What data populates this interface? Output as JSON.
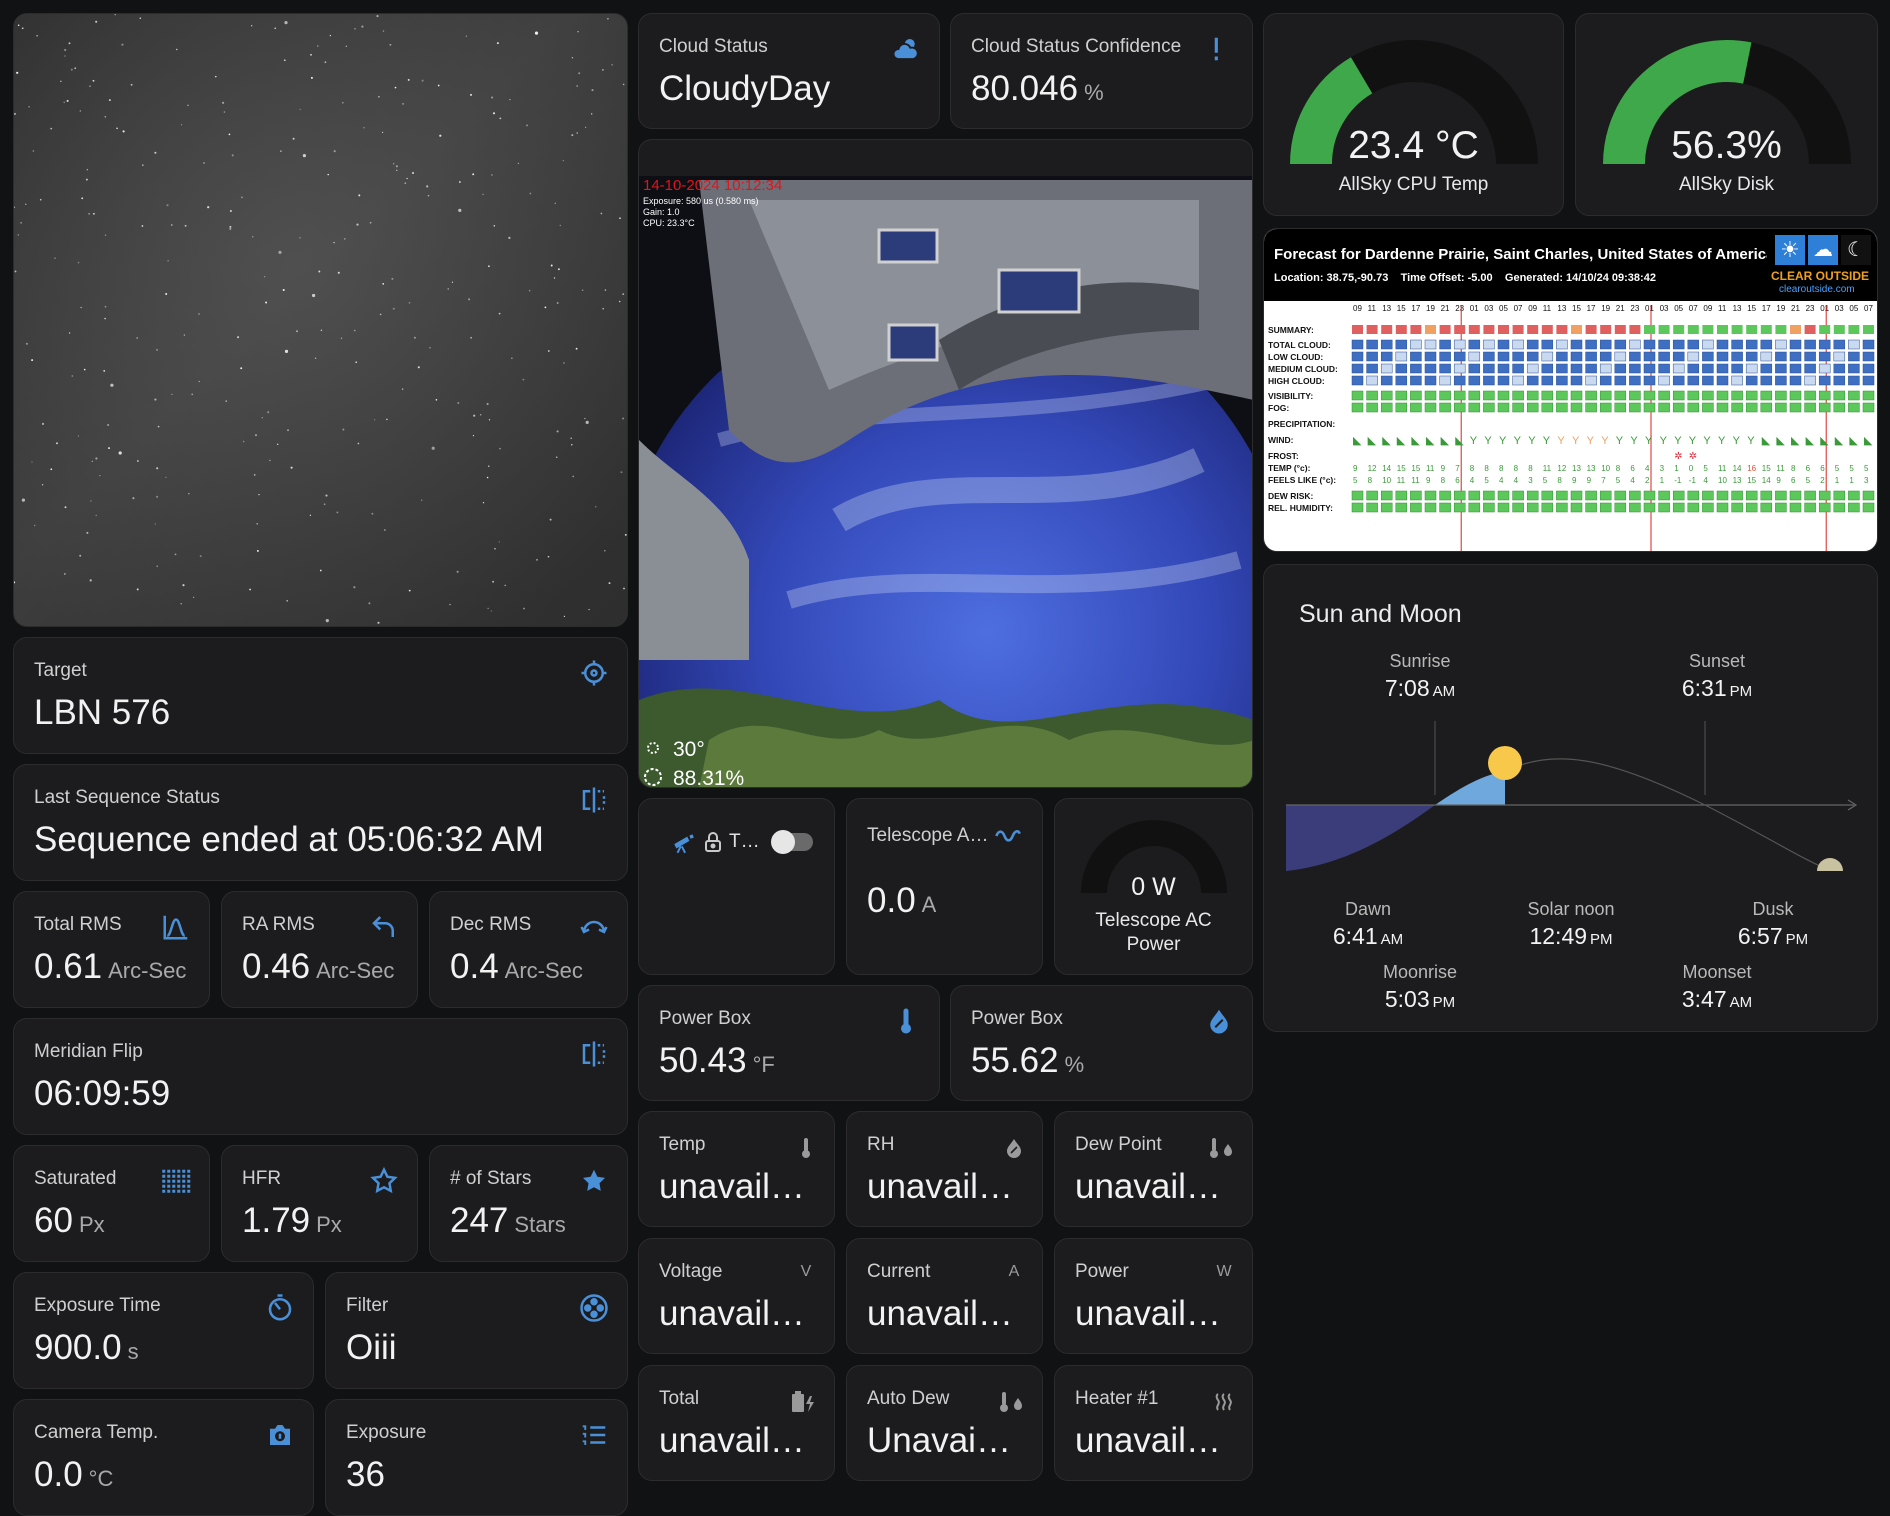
{
  "allsky_image": {},
  "target": {
    "label": "Target",
    "value": "LBN 576"
  },
  "last_sequence": {
    "label": "Last Sequence Status",
    "value": "Sequence ended at 05:06:32 AM"
  },
  "total_rms": {
    "label": "Total RMS",
    "value": "0.61",
    "unit": "Arc-Sec"
  },
  "ra_rms": {
    "label": "RA RMS",
    "value": "0.46",
    "unit": "Arc-Sec"
  },
  "dec_rms": {
    "label": "Dec RMS",
    "value": "0.4",
    "unit": "Arc-Sec"
  },
  "meridian_flip": {
    "label": "Meridian Flip",
    "value": "06:09:59"
  },
  "saturated": {
    "label": "Saturated",
    "value": "60",
    "unit": "Px"
  },
  "hfr": {
    "label": "HFR",
    "value": "1.79",
    "unit": "Px"
  },
  "stars": {
    "label": "# of Stars",
    "value": "247",
    "unit": "Stars"
  },
  "exposure_time": {
    "label": "Exposure Time",
    "value": "900.0",
    "unit": "s"
  },
  "filter": {
    "label": "Filter",
    "value": "Oiii"
  },
  "camera_temp": {
    "label": "Camera Temp.",
    "value": "0.0",
    "unit": "°C"
  },
  "exposure": {
    "label": "Exposure",
    "value": "36"
  },
  "cloud_status": {
    "label": "Cloud Status",
    "value": "CloudyDay"
  },
  "cloud_confidence": {
    "label": "Cloud Status Confidence",
    "value": "80.046",
    "unit": "%"
  },
  "fisheye": {
    "timestamp": "14-10-2024 10:12:34",
    "exposure_line": "Exposure: 580 us (0.580 ms)",
    "gain_line": "Gain: 1.0",
    "cpu_line": "CPU: 23.3°C",
    "sun_alt": "30°",
    "moon_illum": "88.31%"
  },
  "telescope_switch": {
    "label": "T…",
    "on": false
  },
  "telescope_amps": {
    "label": "Telescope A…",
    "value": "0.0",
    "unit": "A"
  },
  "telescope_power": {
    "value": "0 W",
    "label_line1": "Telescope AC",
    "label_line2": "Power",
    "level": 0
  },
  "power_box_temp": {
    "label": "Power Box",
    "value": "50.43",
    "unit": "°F"
  },
  "power_box_hum": {
    "label": "Power Box",
    "value": "55.62",
    "unit": "%"
  },
  "small_tiles": {
    "temp": {
      "label": "Temp",
      "value": "unavaila…"
    },
    "rh": {
      "label": "RH",
      "value": "unavaila…"
    },
    "dew_point": {
      "label": "Dew Point",
      "value": "unavaila…"
    },
    "voltage": {
      "label": "Voltage",
      "value": "unavaila…",
      "icon": "V"
    },
    "current": {
      "label": "Current",
      "value": "unavaila…",
      "icon": "A"
    },
    "power": {
      "label": "Power",
      "value": "unavaila…",
      "icon": "W"
    },
    "total": {
      "label": "Total",
      "value": "unavaila…"
    },
    "auto_dew": {
      "label": "Auto Dew",
      "value": "Unavaila…"
    },
    "heater1": {
      "label": "Heater #1",
      "value": "unavaila…"
    }
  },
  "cpu_temp": {
    "value": "23.4 °C",
    "label": "AllSky CPU Temp",
    "level": 0.33
  },
  "disk": {
    "value": "56.3%",
    "label": "AllSky Disk",
    "level": 0.563
  },
  "clear_outside": {
    "title": "Forecast for Dardenne Prairie, Saint Charles, United States of America",
    "location": "Location: 38.75,-90.73",
    "offset": "Time Offset: -5.00",
    "generated": "Generated: 14/10/24 09:38:42",
    "brand": "CLEAR OUTSIDE",
    "site": "clearoutside.com",
    "hours": [
      "09",
      "11",
      "13",
      "15",
      "17",
      "19",
      "21",
      "23",
      "01",
      "03",
      "05",
      "07",
      "09",
      "11",
      "13",
      "15",
      "17",
      "19",
      "21",
      "23",
      "01",
      "03",
      "05",
      "07",
      "09",
      "11",
      "13",
      "15",
      "17",
      "19",
      "21",
      "23",
      "01",
      "03",
      "05",
      "07"
    ],
    "rows": [
      "SUMMARY:",
      "TOTAL CLOUD:",
      "LOW CLOUD:",
      "MEDIUM CLOUD:",
      "HIGH CLOUD:",
      "VISIBILITY:",
      "FOG:",
      "PRECIPITATION:",
      "WIND:",
      "FROST:",
      "TEMP (°c):",
      "FEELS LIKE (°c):",
      "DEW RISK:",
      "REL. HUMIDITY:"
    ],
    "summary": [
      "r",
      "r",
      "r",
      "r",
      "r",
      "o",
      "r",
      "r",
      "r",
      "r",
      "r",
      "r",
      "r",
      "r",
      "r",
      "o",
      "r",
      "r",
      "r",
      "r",
      "g",
      "g",
      "g",
      "g",
      "g",
      "g",
      "g",
      "g",
      "g",
      "g",
      "o",
      "r",
      "g",
      "g",
      "g",
      "g"
    ],
    "temp": [
      "9",
      "12",
      "14",
      "15",
      "15",
      "11",
      "9",
      "7",
      "8",
      "8",
      "8",
      "8",
      "8",
      "11",
      "12",
      "13",
      "13",
      "10",
      "8",
      "6",
      "4",
      "3",
      "1",
      "0",
      "5",
      "11",
      "14",
      "16",
      "15",
      "11",
      "8",
      "6",
      "6",
      "5",
      "5",
      "5"
    ],
    "feels": [
      "5",
      "8",
      "10",
      "11",
      "11",
      "9",
      "8",
      "6",
      "4",
      "5",
      "4",
      "4",
      "3",
      "5",
      "8",
      "9",
      "9",
      "7",
      "5",
      "4",
      "2",
      "1",
      "-1",
      "-1",
      "4",
      "10",
      "13",
      "15",
      "14",
      "9",
      "6",
      "5",
      "2",
      "1",
      "1",
      "3"
    ]
  },
  "sun_moon": {
    "title": "Sun and Moon",
    "sunrise": {
      "label": "Sunrise",
      "time": "7:08",
      "ampm": "AM"
    },
    "sunset": {
      "label": "Sunset",
      "time": "6:31",
      "ampm": "PM"
    },
    "dawn": {
      "label": "Dawn",
      "time": "6:41",
      "ampm": "AM"
    },
    "solar_noon": {
      "label": "Solar noon",
      "time": "12:49",
      "ampm": "PM"
    },
    "dusk": {
      "label": "Dusk",
      "time": "6:57",
      "ampm": "PM"
    },
    "moonrise": {
      "label": "Moonrise",
      "time": "5:03",
      "ampm": "PM"
    },
    "moonset": {
      "label": "Moonset",
      "time": "3:47",
      "ampm": "AM"
    }
  },
  "colors": {
    "accent": "#4a90d9",
    "gauge_green": "#3fa84a",
    "gauge_track": "#111111",
    "card": "#1c1c1e"
  }
}
